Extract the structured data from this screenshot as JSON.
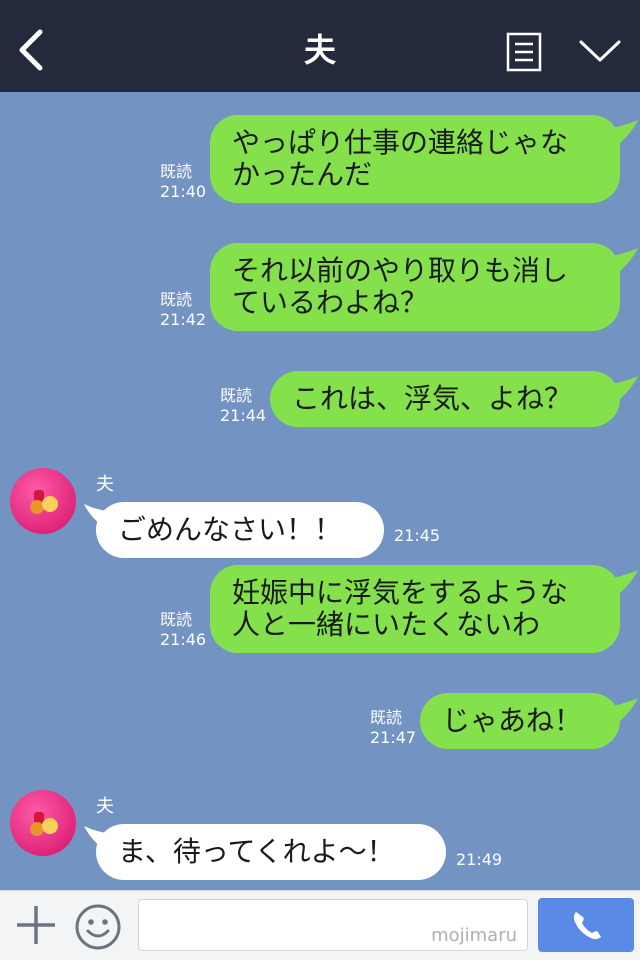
{
  "header": {
    "title": "夫"
  },
  "messages": [
    {
      "dir": "out",
      "text": "やっぱり仕事の連絡じゃなかったんだ",
      "lines": [
        "やっぱり仕事の連絡じゃな",
        "かったんだ"
      ],
      "read": "既読",
      "time": "21:40"
    },
    {
      "dir": "out",
      "text": "それ以前のやり取りも消しているわよね？",
      "lines": [
        "それ以前のやり取りも消し",
        "ているわよね？"
      ],
      "read": "既読",
      "time": "21:42"
    },
    {
      "dir": "out",
      "text": "これは、浮気、よね？",
      "lines": [
        "これは、浮気、よね？"
      ],
      "read": "既読",
      "time": "21:44"
    },
    {
      "dir": "in",
      "sender": "夫",
      "text": "ごめんなさい！！",
      "lines": [
        "ごめんなさい！！"
      ],
      "time": "21:45"
    },
    {
      "dir": "out",
      "text": "妊娠中に浮気をするような人と一緒にいたくないわ",
      "lines": [
        "妊娠中に浮気をするような",
        "人と一緒にいたくないわ"
      ],
      "read": "既読",
      "time": "21:46"
    },
    {
      "dir": "out",
      "text": "じゃあね！",
      "lines": [
        "じゃあね！"
      ],
      "read": "既読",
      "time": "21:47"
    },
    {
      "dir": "in",
      "sender": "夫",
      "text": "ま、待ってくれよ〜！",
      "lines": [
        "ま、待ってくれよ〜！"
      ],
      "time": "21:49"
    }
  ],
  "footer": {
    "input_value": "",
    "watermark": "mojimaru"
  },
  "colors": {
    "header_bg": "#232a3b",
    "chat_bg": "#7393c2",
    "out_bubble": "#84e14c",
    "in_bubble": "#ffffff",
    "call_button": "#5a8ae6"
  },
  "icons": {
    "back": "chevron-left-icon",
    "notes": "notes-icon",
    "menu": "chevron-down-icon",
    "plus": "plus-icon",
    "emoji": "smiley-icon",
    "call": "phone-icon"
  }
}
